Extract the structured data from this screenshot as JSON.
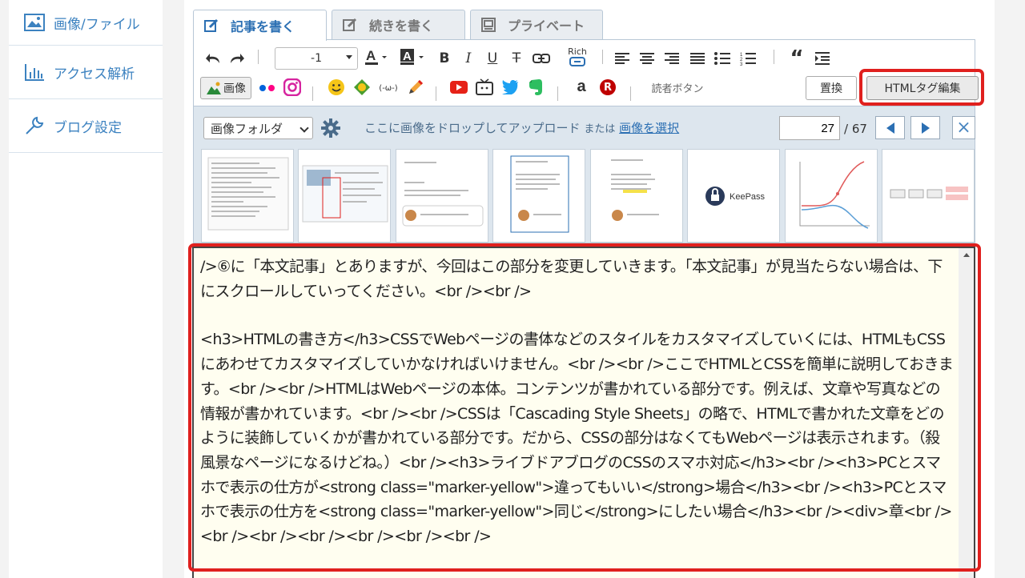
{
  "sidebar": {
    "items": [
      {
        "label": "画像/ファイル",
        "icon": "image-file-icon"
      },
      {
        "label": "アクセス解析",
        "icon": "bar-chart-icon"
      },
      {
        "label": "ブログ設定",
        "icon": "wrench-icon"
      }
    ]
  },
  "tabs": [
    {
      "label": "記事を書く",
      "icon": "edit-icon",
      "active": true
    },
    {
      "label": "続きを書く",
      "icon": "edit-icon",
      "active": false
    },
    {
      "label": "プライベート",
      "icon": "private-icon",
      "active": false
    }
  ],
  "toolbar": {
    "font_size": "-1",
    "rich_label": "Rich",
    "image_label": "画像",
    "reader_button_label": "読者ボタン",
    "replace_label": "置換",
    "html_edit_label": "HTMLタグ編集",
    "emoticon_label": "(-ω-)",
    "amazon_label": "a",
    "rakuten_label": "R"
  },
  "image_bar": {
    "folder_select": "画像フォルダ",
    "drop_text": "ここに画像をドロップしてアップロード",
    "or_text": "または",
    "select_link": "画像を選択",
    "page_current": "27",
    "page_total": "/ 67",
    "close": "×",
    "thumb_keepass_label": "KeePass"
  },
  "editor": {
    "paragraphs": [
      "/>⑥に「本文記事」とありますが、今回はこの部分を変更していきます。「本文記事」が見当たらない場合は、下にスクロールしていってください。<br /><br />",
      "<h3>HTMLの書き方</h3>CSSでWebページの書体などのスタイルをカスタマイズしていくには、HTMLもCSSにあわせてカスタマイズしていかなければいけません。<br /><br />ここでHTMLとCSSを簡単に説明しておきます。<br /><br />HTMLはWebページの本体。コンテンツが書かれている部分です。例えば、文章や写真などの情報が書かれています。<br /><br />CSSは「Cascading Style Sheets」の略で、HTMLで書かれた文章をどのように装飾していくかが書かれている部分です。だから、CSSの部分はなくてもWebページは表示されます。（殺風景なページになるけどね。）<br /><h3>ライブドアブログのCSSのスマホ対応</h3><br /><h3>PCとスマホで表示の仕方が<strong class=\"marker-yellow\">違ってもいい</strong>場合</h3><br /><h3>PCとスマホで表示の仕方を<strong  class=\"marker-yellow\">同じ</strong>にしたい場合</h3><br /><div>章<br /><br /><br /><br /><br /><br /><br />"
    ]
  },
  "colors": {
    "accent": "#2b6fb3",
    "highlight": "#e0201e",
    "editor_bg": "#fffef0",
    "image_bar_bg": "#dde6ee"
  }
}
